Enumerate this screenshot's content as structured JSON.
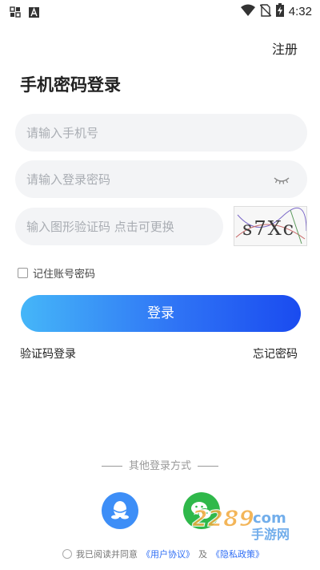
{
  "status_bar": {
    "time": "4:32",
    "left_icons": [
      "notification-icon",
      "app-a-icon"
    ],
    "right_icons": [
      "wifi-icon",
      "no-sim-icon",
      "battery-charging-icon"
    ]
  },
  "header": {
    "register_label": "注册",
    "title": "手机密码登录"
  },
  "form": {
    "phone_placeholder": "请输入手机号",
    "password_placeholder": "请输入登录密码",
    "captcha_placeholder": "输入图形验证码 点击可更换",
    "captcha_text": "s7Xc",
    "password_toggle_icon": "eye-closed-icon",
    "remember_label": "记住账号密码",
    "remember_checked": false
  },
  "actions": {
    "login_label": "登录",
    "sms_login_label": "验证码登录",
    "forgot_label": "忘记密码"
  },
  "other_login": {
    "title": "其他登录方式",
    "options": [
      {
        "icon": "qq-icon",
        "color": "#3d8ef7"
      },
      {
        "icon": "wechat-icon",
        "color": "#2fb84a"
      }
    ]
  },
  "watermark": {
    "text": "2289.com 手游网"
  },
  "agreement": {
    "prefix": "我已阅读并同意",
    "user_agreement": "《用户协议》",
    "and": "及",
    "privacy_policy": "《隐私政策》",
    "checked": false
  },
  "colors": {
    "primary": "#2f74f5",
    "gradient_start": "#45b6f8",
    "gradient_end": "#1a4bf0",
    "field_bg": "#f3f4f6",
    "link": "#2f6ef5"
  }
}
